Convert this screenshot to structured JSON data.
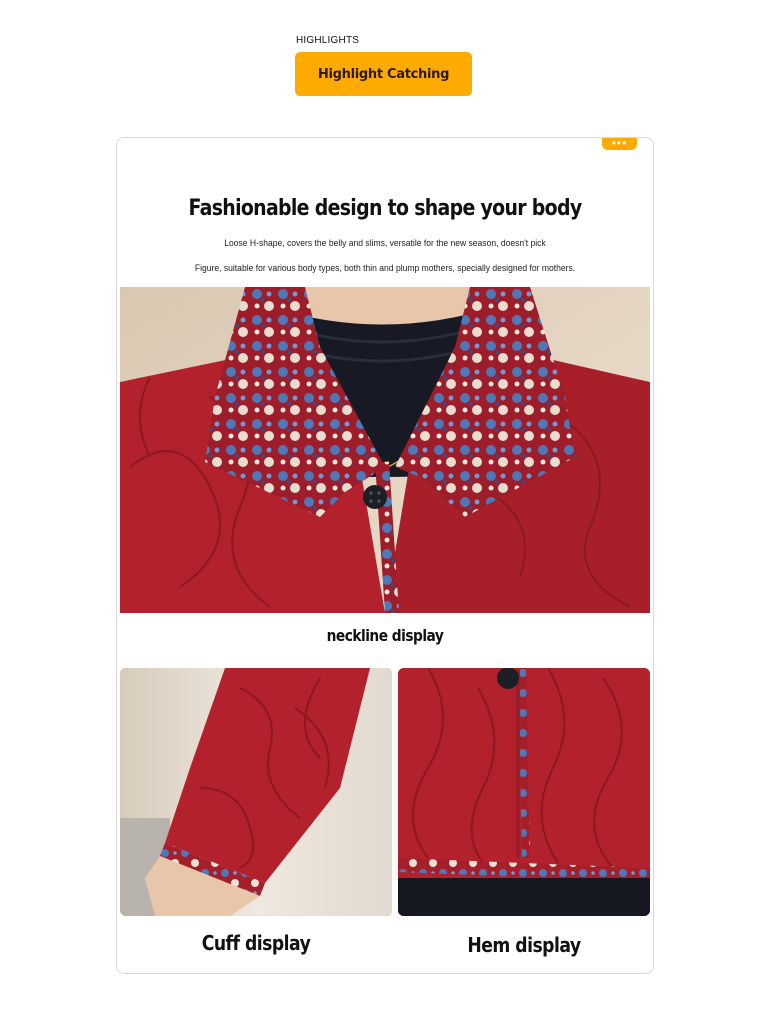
{
  "header": {
    "eyebrow": "HIGHLIGHTS",
    "pill_label": "Highlight Catching"
  },
  "card": {
    "more_icon": "ellipsis-icon",
    "title": "Fashionable design to shape your body",
    "subtitle_line1": "Loose H-shape, covers the belly and slims, versatile for the new season, doesn't pick",
    "subtitle_line2": "Figure, suitable for various body types, both thin and plump mothers, specially designed for mothers.",
    "captions": {
      "neckline": "neckline display",
      "cuff": "Cuff display",
      "hem": "Hem display"
    }
  },
  "colors": {
    "accent": "#FFAA00",
    "coat_red": "#B3222C",
    "print_blue": "#4E78B8"
  }
}
